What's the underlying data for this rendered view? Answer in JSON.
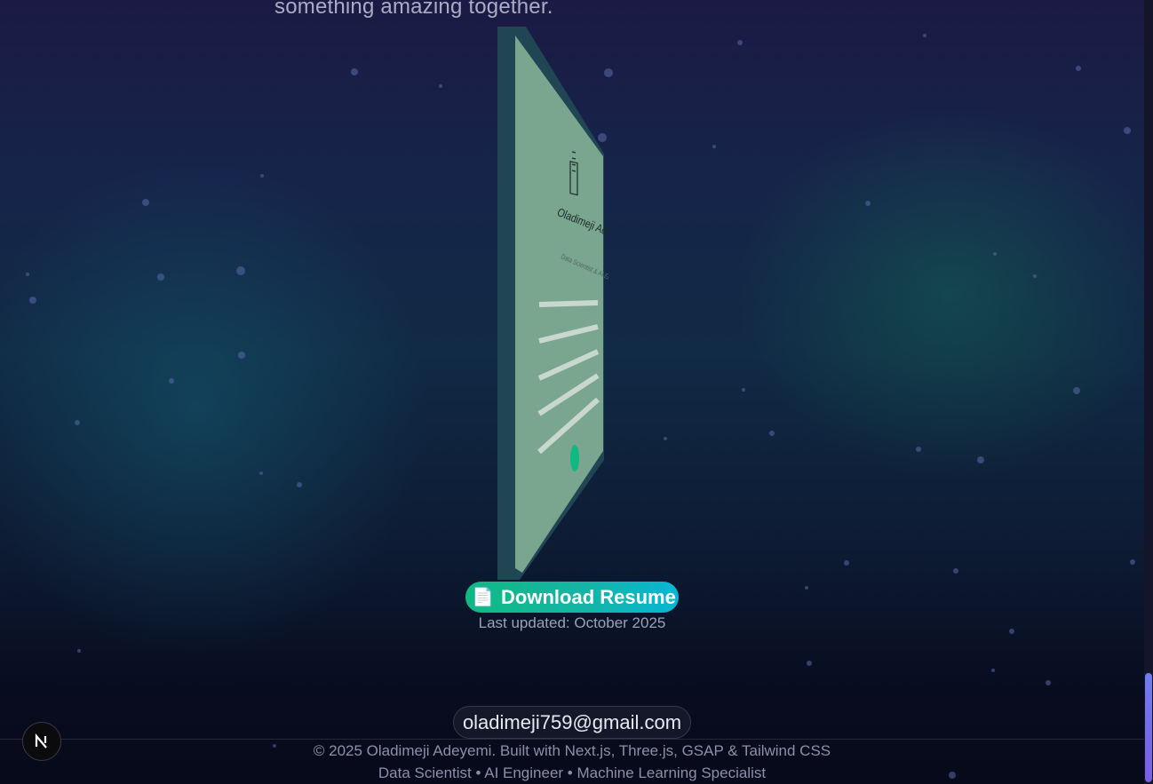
{
  "contact": {
    "subtitle_tail": "something amazing together."
  },
  "resume": {
    "card_name": "Oladimeji Adeyemi",
    "card_role": "Data Scientist & AI Engineer",
    "card_icon": "document-icon",
    "download_label": "Download Resume",
    "download_icon": "page-facing-up-icon",
    "last_updated": "Last updated: October 2025"
  },
  "footer": {
    "email": "oladimeji759@gmail.com",
    "copyright": "© 2025 Oladimeji Adeyemi. Built with Next.js, Three.js, GSAP & Tailwind CSS",
    "tagline": "Data Scientist • AI Engineer • Machine Learning Specialist"
  },
  "dev_badge": {
    "letter": "N",
    "icon": "nextjs-dev-indicator-icon"
  },
  "colors": {
    "accent_green": "#10b981",
    "accent_cyan": "#06b6d4",
    "card_face": "#7aa58e",
    "card_edge": "#1f4652",
    "scroll_thumb": "#7c5ce6"
  }
}
